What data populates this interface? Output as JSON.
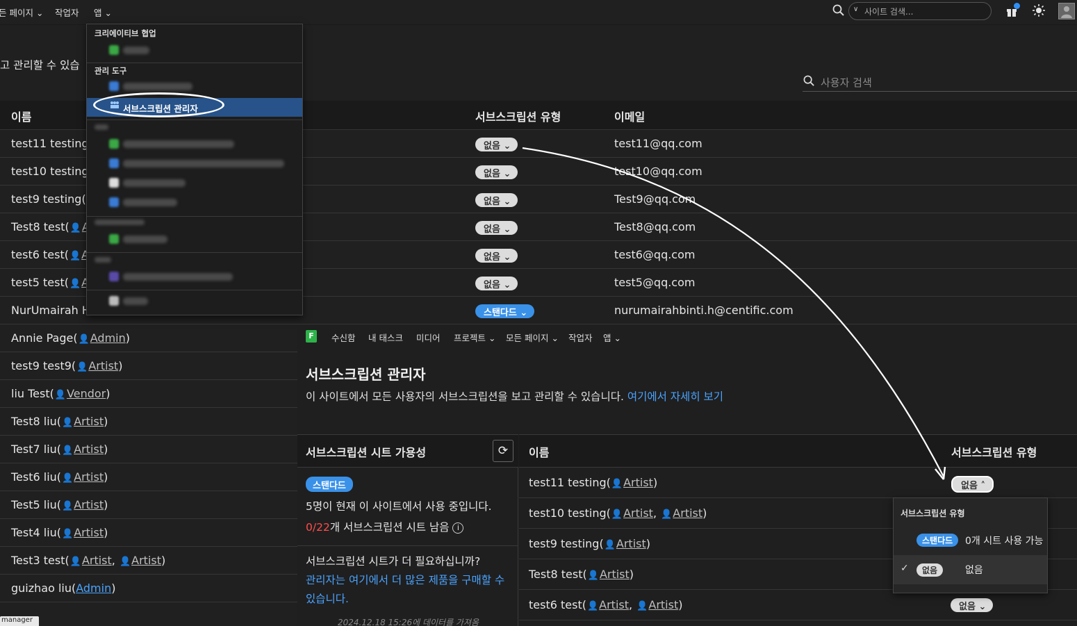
{
  "topbar": {
    "nav": [
      "든 페이지",
      "작업자",
      "앱"
    ],
    "search_placeholder": "사이트 검색..."
  },
  "background_page": {
    "description_fragment": "고 관리할 수 있습",
    "user_search_placeholder": "사용자 검색",
    "table": {
      "headers": {
        "name": "이름",
        "subscription_type": "서브스크립션 유형",
        "email": "이메일"
      },
      "rows": [
        {
          "name": "test11 testing(",
          "subscription": "없음",
          "email": "test11@qq.com"
        },
        {
          "name": "test10 testing(",
          "subscription": "없음",
          "email": "test10@qq.com"
        },
        {
          "name": "test9 testing(",
          "subscription": "없음",
          "email": "Test9@qq.com"
        },
        {
          "name": "Test8 test(",
          "role": "A",
          "subscription": "없음",
          "email": "Test8@qq.com"
        },
        {
          "name": "test6 test(",
          "role": "A",
          "subscription": "없음",
          "email": "test6@qq.com"
        },
        {
          "name": "test5 test(",
          "role": "A",
          "subscription": "없음",
          "email": "test5@qq.com"
        },
        {
          "name": "NurUmairah H",
          "subscription": "스탠다드",
          "email": "nurumairahbinti.h@centific.com"
        },
        {
          "name": "Annie Page(",
          "role": "Admin",
          "suffix": ")"
        },
        {
          "name": "test9 test9(",
          "role": "Artist",
          "suffix": ")"
        },
        {
          "name": "liu Test(",
          "role": "Vendor",
          "suffix": ")"
        },
        {
          "name": "Test8 liu(",
          "role": "Artist",
          "suffix": ")"
        },
        {
          "name": "Test7 liu(",
          "role": "Artist",
          "suffix": ")"
        },
        {
          "name": "Test6 liu(",
          "role": "Artist",
          "suffix": ")"
        },
        {
          "name": "Test5 liu(",
          "role": "Artist",
          "suffix": ")"
        },
        {
          "name": "Test4 liu(",
          "role": "Artist",
          "suffix": ")"
        },
        {
          "name": "Test3 test(",
          "role": "Artist",
          "role2": "Artist",
          "suffix": ")"
        },
        {
          "name": "guizhao liu(",
          "role": "Admin",
          "suffix": ")"
        }
      ]
    },
    "manager_tab": "manager"
  },
  "app_menu": {
    "section_creative": "크리에이티브 협업",
    "section_admin": "관리 도구",
    "selected_item": "서브스크립션 관리자"
  },
  "inset": {
    "nav": [
      "수신함",
      "내 태스크",
      "미디어",
      "프로젝트",
      "모든 페이지",
      "작업자",
      "앱"
    ],
    "logo": "F",
    "title": "서브스크립션 관리자",
    "description": "이 사이트에서 모든 사용자의 서브스크립션을 보고 관리할 수 있습니다.",
    "description_link": "여기에서 자세히 보기",
    "seat_panel": {
      "title": "서브스크립션 시트 가용성",
      "badge": "스탠다드",
      "in_use_count": "5",
      "in_use_text": "명이 현재 이 사이트에서 사용 중입니다.",
      "remaining_count": "0",
      "remaining_total": "/22",
      "remaining_text": "개 서브스크립션 시트 남음",
      "need_more": "서브스크립션 시트가 더 필요하십니까?",
      "buy_more": "관리자는 여기에서 더 많은 제품을 구매할 수 있습니다.",
      "updated": "2024.12.18 15:26에 데이터를 가져옴"
    },
    "table": {
      "headers": {
        "name": "이름",
        "subscription_type": "서브스크립션 유형"
      },
      "rows": [
        {
          "name": "test11 testing(",
          "roles": [
            "Artist"
          ],
          "subscription": "없음"
        },
        {
          "name": "test10 testing(",
          "roles": [
            "Artist",
            "Artist"
          ]
        },
        {
          "name": "test9 testing(",
          "roles": [
            "Artist"
          ]
        },
        {
          "name": "Test8 test(",
          "roles": [
            "Artist"
          ]
        },
        {
          "name": "test6 test(",
          "roles": [
            "Artist",
            "Artist"
          ],
          "subscription": "없음"
        }
      ]
    },
    "subscription_popup": {
      "title": "서브스크립션 유형",
      "options": [
        {
          "badge": "스탠다드",
          "label": "0개 시트 사용 가능"
        },
        {
          "badge": "없음",
          "label": "없음",
          "checked": true
        }
      ]
    }
  },
  "colors": {
    "accent_blue": "#3a91e8",
    "link_blue": "#4aa3ff",
    "menu_selected": "#27538a",
    "danger_red": "#ff4d4d"
  }
}
